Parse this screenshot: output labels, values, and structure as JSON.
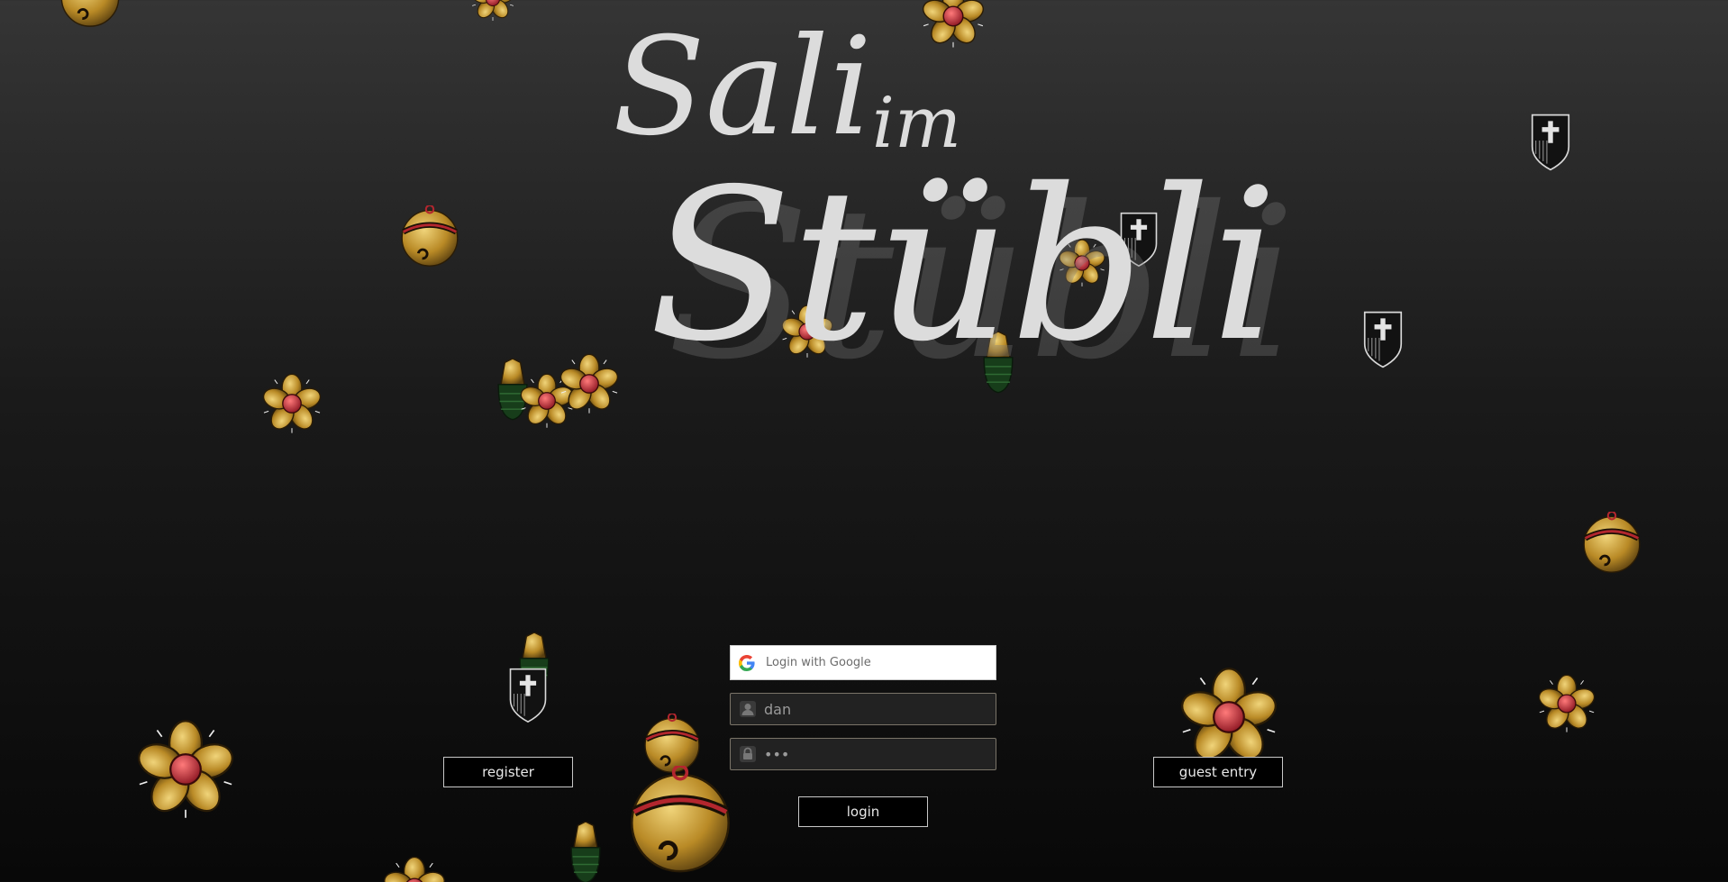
{
  "title": {
    "line1": "Sali",
    "line1b": "im",
    "line2": "Stübli"
  },
  "login_panel": {
    "google_label": "Login with Google",
    "username_value": "dan",
    "password_value": "•••",
    "login_label": "login"
  },
  "side_buttons": {
    "register_label": "register",
    "guest_label": "guest entry"
  },
  "colors": {
    "background_top": "#353535",
    "background_bottom": "#080808",
    "title": "#dcdcdc",
    "gold": "#c9a23a",
    "red": "#c0343a"
  },
  "decorations": [
    "flower-icon",
    "bell-icon",
    "shield-icon",
    "acorn-icon"
  ]
}
